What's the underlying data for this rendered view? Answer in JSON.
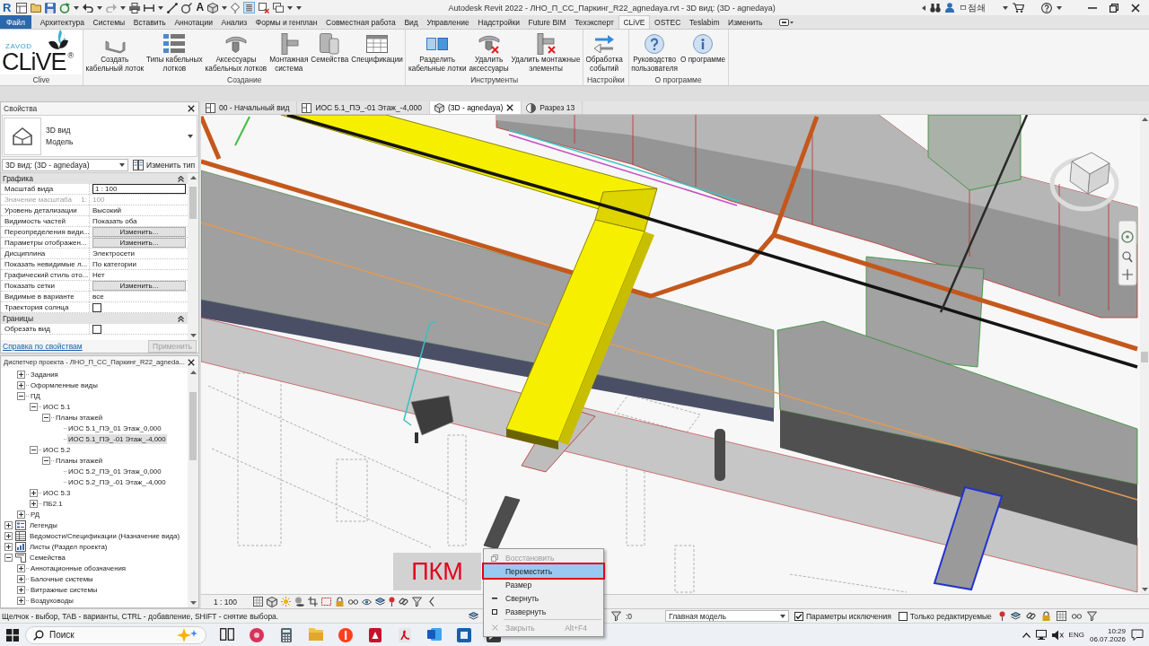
{
  "title_bar": {
    "app_logo": "R",
    "text_tool": "A",
    "thin_lines_on": true,
    "title": "Autodesk Revit 2022 - ЛНО_П_СС_Паркинг_R22_agnedaya.rvt - 3D вид: (3D - agnedaya)",
    "user": "ㅁ점쇄"
  },
  "menu_tabs": [
    {
      "label": "Файл",
      "kind": "file",
      "selected": false
    },
    {
      "label": "Архитектура",
      "kind": "tab",
      "selected": false
    },
    {
      "label": "Системы",
      "kind": "tab",
      "selected": false
    },
    {
      "label": "Вставить",
      "kind": "tab",
      "selected": false
    },
    {
      "label": "Аннотации",
      "kind": "tab",
      "selected": false
    },
    {
      "label": "Анализ",
      "kind": "tab",
      "selected": false
    },
    {
      "label": "Формы и генплан",
      "kind": "tab",
      "selected": false
    },
    {
      "label": "Совместная работа",
      "kind": "tab",
      "selected": false
    },
    {
      "label": "Вид",
      "kind": "tab",
      "selected": false
    },
    {
      "label": "Управление",
      "kind": "tab",
      "selected": false
    },
    {
      "label": "Надстройки",
      "kind": "tab",
      "selected": false
    },
    {
      "label": "Future BIM",
      "kind": "tab",
      "selected": false
    },
    {
      "label": "Техэксперт",
      "kind": "tab",
      "selected": false
    },
    {
      "label": "CLiVE",
      "kind": "tab",
      "selected": true
    },
    {
      "label": "OSTEC",
      "kind": "tab",
      "selected": false
    },
    {
      "label": "Teslabim",
      "kind": "tab",
      "selected": false
    },
    {
      "label": "Изменить",
      "kind": "tab",
      "selected": false
    }
  ],
  "ribbon": {
    "logo_panel": {
      "subtitle": "ZAVOD",
      "name": "CLiVE",
      "mark": "®",
      "title": "Clive"
    },
    "panels": [
      {
        "title": "Создание",
        "buttons": [
          {
            "label": "Создать\nкабельный лоток"
          },
          {
            "label": "Типы кабельных\nлотков"
          },
          {
            "label": "Аксессуары\nкабельных лотков"
          },
          {
            "label": "Монтажная\nсистема"
          },
          {
            "label": "Семейства"
          },
          {
            "label": "Спецификации"
          }
        ]
      },
      {
        "title": "Инструменты",
        "buttons": [
          {
            "label": "Разделить\nкабельные лотки"
          },
          {
            "label": "Удалить\nаксессуары"
          },
          {
            "label": "Удалить монтажные\nэлементы"
          }
        ]
      },
      {
        "title": "Настройки",
        "buttons": [
          {
            "label": "Обработка\nсобытий"
          }
        ]
      },
      {
        "title": "О программе",
        "buttons": [
          {
            "label": "Руководство\nпользователя"
          },
          {
            "label": "О программе"
          }
        ]
      }
    ]
  },
  "properties": {
    "title": "Свойства",
    "type_name": "3D вид",
    "type_category": "Модель",
    "view": "3D вид: (3D - agnedaya)",
    "edit_type": "Изменить тип",
    "groups": [
      {
        "title": "Графика",
        "rows": [
          {
            "name": "Масштаб вида",
            "kind": "field",
            "value": "1 : 100",
            "disabled": false
          },
          {
            "name": "Значение масштаба",
            "suffix": "1:",
            "kind": "text",
            "value": "100",
            "disabled": true
          },
          {
            "name": "Уровень детализации",
            "kind": "text",
            "value": "Высокий",
            "disabled": false
          },
          {
            "name": "Видимость частей",
            "kind": "text",
            "value": "Показать оба",
            "disabled": false
          },
          {
            "name": "Переопределения види...",
            "kind": "button",
            "value": "Изменить...",
            "disabled": false
          },
          {
            "name": "Параметры отображен...",
            "kind": "button",
            "value": "Изменить...",
            "disabled": false
          },
          {
            "name": "Дисциплина",
            "kind": "text",
            "value": "Электросети",
            "disabled": false
          },
          {
            "name": "Показать невидимые л...",
            "kind": "text",
            "value": "По категории",
            "disabled": false
          },
          {
            "name": "Графический стиль ото...",
            "kind": "text",
            "value": "Нет",
            "disabled": false
          },
          {
            "name": "Показать сетки",
            "kind": "button",
            "value": "Изменить...",
            "disabled": false
          },
          {
            "name": "Видимые в варианте",
            "kind": "text",
            "value": "все",
            "disabled": false
          },
          {
            "name": "Траектория солнца",
            "kind": "checkbox",
            "checked": false,
            "disabled": false
          }
        ]
      },
      {
        "title": "Границы",
        "rows": [
          {
            "name": "Обрезать вид",
            "kind": "checkbox",
            "checked": false,
            "disabled": false
          }
        ]
      }
    ],
    "help_link": "Справка по свойствам",
    "apply": {
      "label": "Применить",
      "disabled": true
    }
  },
  "project_browser": {
    "title": "Диспетчер проекта - ЛНО_П_СС_Паркинг_R22_agneda...",
    "scrolled_branch": [
      {
        "label": "Задания",
        "expanded": false,
        "selected": false
      },
      {
        "label": "Оформленные виды",
        "expanded": false,
        "selected": false
      },
      {
        "label": "ПД",
        "expanded": true,
        "selected": false,
        "children": [
          {
            "label": "ИОС 5.1",
            "expanded": true,
            "selected": false,
            "children": [
              {
                "label": "Планы этажей",
                "expanded": true,
                "selected": false,
                "children": [
                  {
                    "label": "ИОС 5.1_ПЭ_01 Этаж_0,000",
                    "selected": false
                  },
                  {
                    "label": "ИОС 5.1_ПЭ_-01 Этаж_-4,000",
                    "selected": true
                  }
                ]
              }
            ]
          },
          {
            "label": "ИОС 5.2",
            "expanded": true,
            "selected": false,
            "children": [
              {
                "label": "Планы этажей",
                "expanded": true,
                "selected": false,
                "children": [
                  {
                    "label": "ИОС 5.2_ПЭ_01 Этаж_0,000",
                    "selected": false
                  },
                  {
                    "label": "ИОС 5.2_ПЭ_-01 Этаж_-4,000",
                    "selected": false
                  }
                ]
              }
            ]
          },
          {
            "label": "ИОС 5.3",
            "expanded": false,
            "selected": false
          },
          {
            "label": "ПБ2.1",
            "expanded": false,
            "selected": false
          }
        ]
      },
      {
        "label": "РД",
        "expanded": false,
        "selected": false
      }
    ],
    "items": [
      {
        "label": "Легенды",
        "kind": "legends",
        "expanded": false,
        "selected": false
      },
      {
        "label": "Ведомости/Спецификации (Назначение вида)",
        "kind": "schedules",
        "expanded": false,
        "selected": false
      },
      {
        "label": "Листы (Раздел проекта)",
        "kind": "sheets",
        "expanded": false,
        "selected": false
      },
      {
        "label": "Семейства",
        "kind": "families",
        "expanded": true,
        "selected": false,
        "children": [
          {
            "label": "Аннотационные обозначения",
            "expanded": false,
            "selected": false
          },
          {
            "label": "Балочные системы",
            "expanded": false,
            "selected": false
          },
          {
            "label": "Витражные системы",
            "expanded": false,
            "selected": false
          },
          {
            "label": "Воздуховоды",
            "expanded": false,
            "selected": false
          }
        ]
      }
    ]
  },
  "view_tabs": [
    {
      "label": "00 - Начальный вид",
      "kind": "plan",
      "selected": false
    },
    {
      "label": "ИОС 5.1_ПЭ_-01 Этаж_-4,000",
      "kind": "plan",
      "selected": false
    },
    {
      "label": "(3D - agnedaya)",
      "kind": "perspective",
      "selected": true
    },
    {
      "label": "Разрез 13",
      "kind": "section",
      "selected": false
    }
  ],
  "view_bar": {
    "scale": "1 : 100"
  },
  "status_bar": {
    "hint": "Щелчок - выбор, TAB - варианты, CTRL - добавление, SHIFT - снятие выбора.",
    "selection_count": ":0",
    "model": "Главная модель",
    "options": [
      {
        "label": "Параметры исключения",
        "checked": true
      },
      {
        "label": "Только редактируемые",
        "checked": false
      }
    ]
  },
  "taskbar": {
    "search_placeholder": "Поиск",
    "language": "ENG",
    "time": "10:29",
    "date": "06.07.2026"
  },
  "context_menu": {
    "items": [
      {
        "label": "Восстановить",
        "kind": "restore",
        "disabled": true,
        "selected": false
      },
      {
        "label": "Переместить",
        "kind": "plain",
        "disabled": false,
        "selected": true
      },
      {
        "label": "Размер",
        "kind": "plain",
        "disabled": false,
        "selected": false
      },
      {
        "label": "Свернуть",
        "kind": "minimize",
        "disabled": false,
        "selected": false
      },
      {
        "label": "Развернуть",
        "kind": "maximize",
        "disabled": false,
        "selected": false
      },
      {
        "label": "Закрыть",
        "kind": "close",
        "shortcut": "Alt+F4",
        "disabled": true,
        "selected": false
      }
    ]
  },
  "callout": {
    "label": "ПКМ"
  }
}
